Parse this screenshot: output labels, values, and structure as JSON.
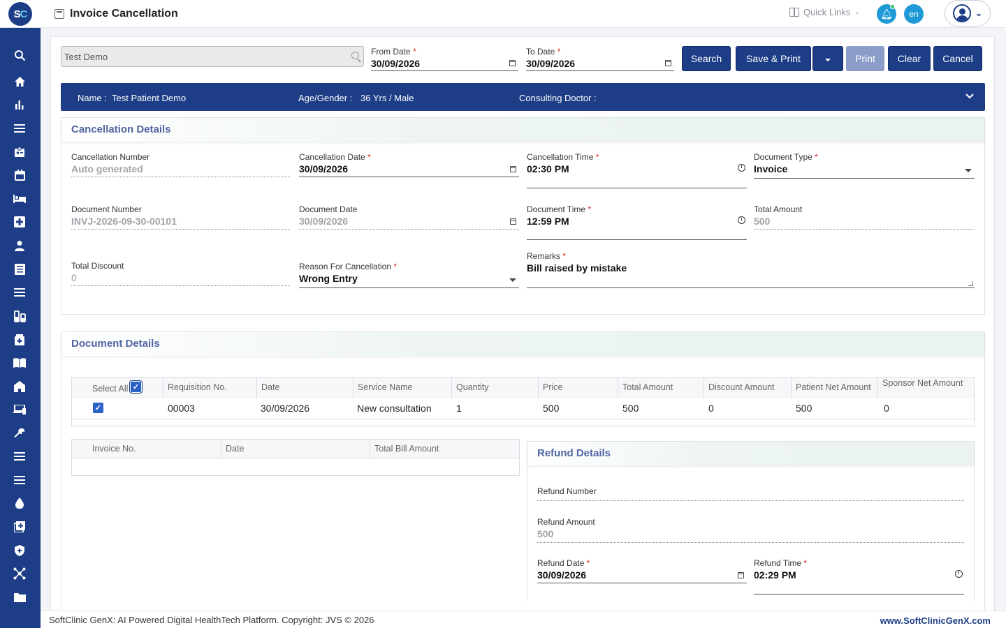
{
  "app": {
    "logo_s": "S",
    "logo_c": "C",
    "page_title": "Invoice Cancellation"
  },
  "header": {
    "quick_links": "Quick Links",
    "lang": "en"
  },
  "sidebar": {
    "items": [
      "search-icon",
      "home-icon",
      "bar-chart-icon",
      "menu-icon",
      "id-card-icon",
      "calendar-icon",
      "bed-icon",
      "medical-plus-icon",
      "person-icon",
      "receipt-icon",
      "list-icon",
      "lab-icon",
      "medicine-box-icon",
      "book-icon",
      "building-icon",
      "devices-icon",
      "wrench-icon",
      "list-alt-icon",
      "menu-alt-icon",
      "drop-icon",
      "add-box-icon",
      "shield-icon",
      "network-icon",
      "folder-icon"
    ]
  },
  "search": {
    "value": "Test Demo"
  },
  "filters": {
    "from_label": "From Date",
    "from_value": "30/09/2026",
    "to_label": "To Date",
    "to_value": "30/09/2026",
    "required": "*"
  },
  "toolbar": {
    "search": "Search",
    "save_print": "Save & Print",
    "print": "Print",
    "clear": "Clear",
    "cancel": "Cancel"
  },
  "patient": {
    "name_label": "Name :",
    "name": "Test Patient Demo",
    "age_label": "Age/Gender :",
    "age": "36 Yrs / Male",
    "doctor_label": "Consulting Doctor :"
  },
  "cancellation": {
    "title": "Cancellation Details",
    "number_label": "Cancellation Number",
    "number": "Auto generated",
    "date_label": "Cancellation Date",
    "date": "30/09/2026",
    "time_label": "Cancellation Time",
    "time": "02:30 PM",
    "doctype_label": "Document Type",
    "doctype": "Invoice",
    "docnum_label": "Document Number",
    "docnum": "INVJ-2026-09-30-00101",
    "docdate_label": "Document Date",
    "docdate": "30/09/2026",
    "doctime_label": "Document Time",
    "doctime": "12:59 PM",
    "total_label": "Total Amount",
    "total": "500",
    "discount_label": "Total Discount",
    "discount": "0",
    "reason_label": "Reason For Cancellation",
    "reason": "Wrong Entry",
    "remarks_label": "Remarks",
    "remarks": "Bill raised by mistake"
  },
  "document": {
    "title": "Document Details",
    "headers": [
      "Select All",
      "Requisition No.",
      "Date",
      "Service Name",
      "Quantity",
      "Price",
      "Total Amount",
      "Discount Amount",
      "Patient Net Amount",
      "Sponsor Net Amount"
    ],
    "rows": [
      [
        "00003",
        "30/09/2026",
        "New consultation",
        "1",
        "500",
        "500",
        "0",
        "500",
        "0"
      ]
    ]
  },
  "invoice_table": {
    "headers": [
      "Invoice No.",
      "Date",
      "Total Bill Amount"
    ]
  },
  "refund": {
    "title": "Refund Details",
    "number_label": "Refund Number",
    "amount_label": "Refund Amount",
    "amount": "500",
    "date_label": "Refund Date",
    "date": "30/09/2026",
    "time_label": "Refund Time",
    "time": "02:29 PM"
  },
  "footer": {
    "left": "SoftClinic GenX: AI Powered Digital HealthTech Platform. Copyright: JVS © 2026",
    "right": "www.SoftClinicGenX.com"
  }
}
